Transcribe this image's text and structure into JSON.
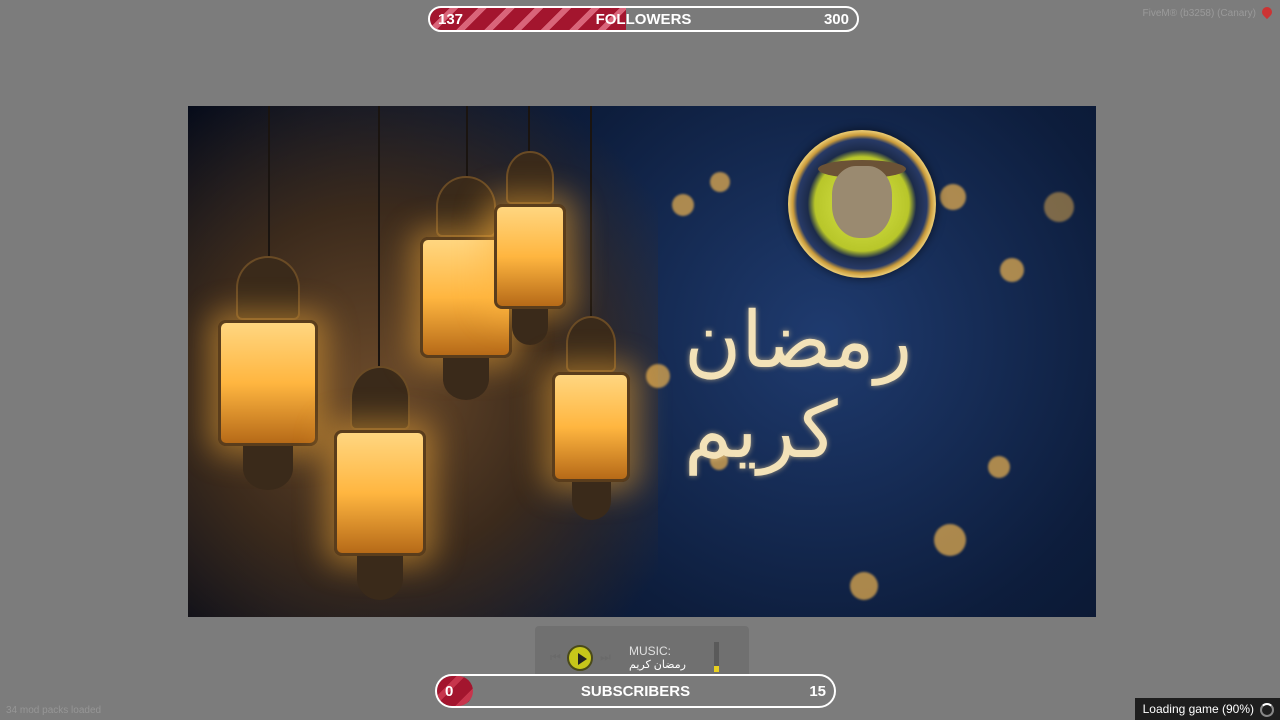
{
  "followers": {
    "current": "137",
    "goal": "300",
    "label": "FOLLOWERS",
    "progress": 0.46
  },
  "subscribers": {
    "current": "0",
    "goal": "15",
    "label": "SUBSCRIBERS",
    "progress": 0.0
  },
  "build_title": "FiveM® (b3258) (Canary)",
  "hero": {
    "calligraphy": "رمضان كريم"
  },
  "music": {
    "label": "MUSIC:",
    "track": "رمضان كريم",
    "volume": 0.2
  },
  "status": {
    "mods": "34 mod packs loaded",
    "loading": "Loading game (90%)"
  },
  "colors": {
    "goal_fill": "#a3152e",
    "background": "#7c7c7c"
  }
}
